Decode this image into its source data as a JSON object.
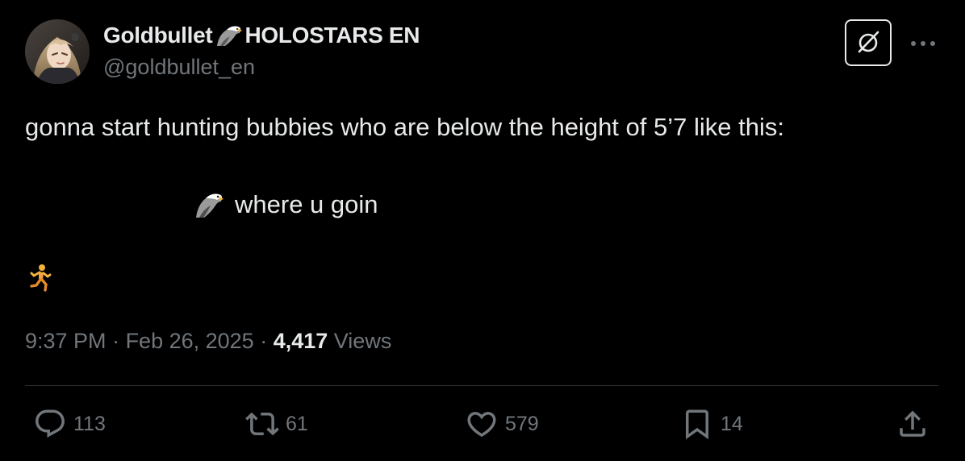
{
  "author": {
    "display_name": "Goldbullet",
    "affiliation": "HOLOSTARS EN",
    "handle": "@goldbullet_en",
    "badge_icon": "eagle-emoji"
  },
  "header_actions": {
    "grok_icon": "grok-icon",
    "more_icon": "more-dots-icon"
  },
  "tweet": {
    "line1": "gonna start hunting bubbies who are below the height of 5’7 like this:",
    "line2_emoji": "eagle-emoji",
    "line2": "where u goin",
    "line3_emoji": "runner-emoji"
  },
  "meta": {
    "time": "9:37 PM",
    "separator1": " · ",
    "date": "Feb 26, 2025",
    "separator2": " · ",
    "views_count": "4,417",
    "views_label": " Views"
  },
  "actions": {
    "replies": "113",
    "reposts": "61",
    "likes": "579",
    "bookmarks": "14"
  },
  "colors": {
    "background": "#000000",
    "primary_text": "#e7e9ea",
    "secondary_text": "#71767b",
    "divider": "#2f3336"
  }
}
